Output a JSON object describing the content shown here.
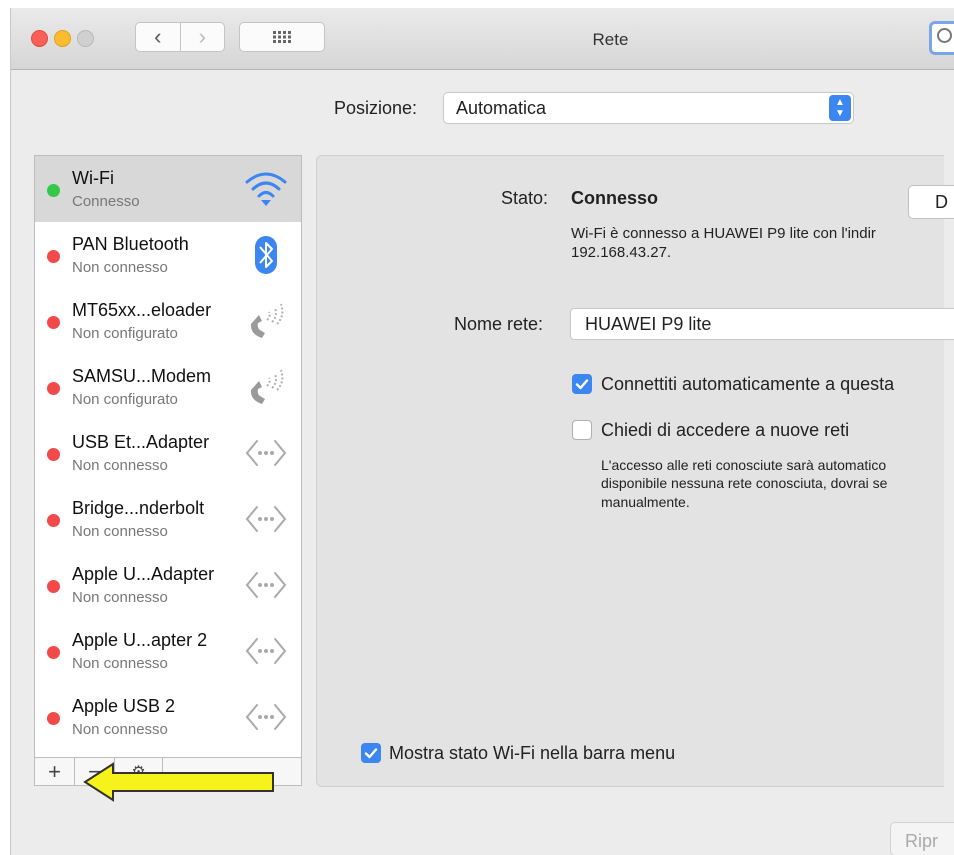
{
  "window": {
    "title": "Rete"
  },
  "location": {
    "label": "Posizione:",
    "value": "Automatica"
  },
  "services": [
    {
      "name": "Wi-Fi",
      "status": "Connesso",
      "state": "connected",
      "icon": "wifi-icon"
    },
    {
      "name": "PAN Bluetooth",
      "status": "Non connesso",
      "state": "disconnected",
      "icon": "bluetooth-icon"
    },
    {
      "name": "MT65xx...eloader",
      "status": "Non configurato",
      "state": "disconnected",
      "icon": "phone-icon"
    },
    {
      "name": "SAMSU...Modem",
      "status": "Non configurato",
      "state": "disconnected",
      "icon": "phone-icon"
    },
    {
      "name": "USB Et...Adapter",
      "status": "Non connesso",
      "state": "disconnected",
      "icon": "ethernet-icon"
    },
    {
      "name": "Bridge...nderbolt",
      "status": "Non connesso",
      "state": "disconnected",
      "icon": "ethernet-icon"
    },
    {
      "name": "Apple U...Adapter",
      "status": "Non connesso",
      "state": "disconnected",
      "icon": "ethernet-icon"
    },
    {
      "name": "Apple U...apter 2",
      "status": "Non connesso",
      "state": "disconnected",
      "icon": "ethernet-icon"
    },
    {
      "name": "Apple USB 2",
      "status": "Non connesso",
      "state": "disconnected",
      "icon": "ethernet-icon"
    }
  ],
  "footer": {
    "add": "+",
    "remove": "−",
    "action": "⚙"
  },
  "detail": {
    "status_label": "Stato:",
    "status_value": "Connesso",
    "status_button": "D",
    "status_desc_1": "Wi-Fi è connesso a HUAWEI P9 lite con l'indir",
    "status_desc_2": "192.168.43.27.",
    "network_label": "Nome rete:",
    "network_value": "HUAWEI P9 lite",
    "auto_join": "Connettiti automaticamente a questa",
    "ask_join": "Chiedi di accedere a nuove reti",
    "ask_desc_1": "L'accesso alle reti conosciute sarà automatico",
    "ask_desc_2": "disponibile nessuna rete conosciuta, dovrai se",
    "ask_desc_3": "manualmente.",
    "show_status": "Mostra stato Wi-Fi nella barra menu"
  },
  "revert_button": "Ripr",
  "colors": {
    "connected": "#34c84a",
    "disconnected": "#f24a4a",
    "accent": "#3b86f0",
    "arrow": "#f6f21a"
  }
}
